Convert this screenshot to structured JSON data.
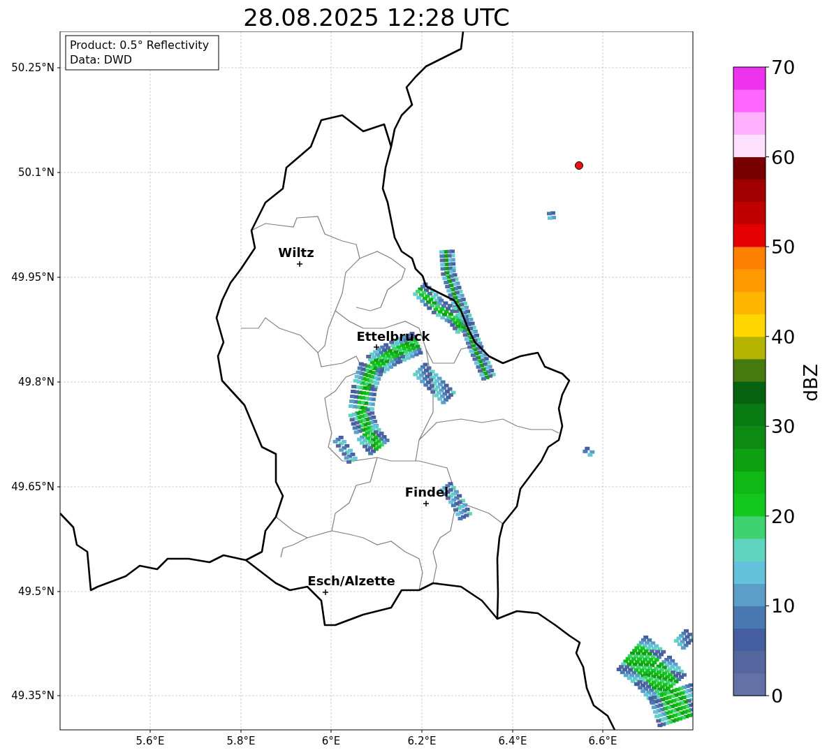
{
  "title": "28.08.2025 12:28 UTC",
  "info_box": [
    "Product: 0.5° Reflectivity",
    "Data: DWD"
  ],
  "map": {
    "lat_ticks": [
      "50.25°N",
      "50.1°N",
      "49.95°N",
      "49.8°N",
      "49.65°N",
      "49.5°N",
      "49.35°N"
    ],
    "lon_ticks": [
      "5.6°E",
      "5.8°E",
      "6°E",
      "6.2°E",
      "6.4°E",
      "6.6°E"
    ],
    "cities": [
      {
        "name": "Wiltz"
      },
      {
        "name": "Ettelbruck"
      },
      {
        "name": "Findel"
      },
      {
        "name": "Esch/Alzette"
      }
    ]
  },
  "colorbar": {
    "label": "dBZ",
    "ticks": [
      "70",
      "60",
      "50",
      "40",
      "30",
      "20",
      "10",
      "0"
    ],
    "segments": [
      {
        "color": "#6471a7"
      },
      {
        "color": "#56679f"
      },
      {
        "color": "#445ea0"
      },
      {
        "color": "#4a78b0"
      },
      {
        "color": "#5b9ec8"
      },
      {
        "color": "#64c2dc"
      },
      {
        "color": "#5fd5c0"
      },
      {
        "color": "#3ed370"
      },
      {
        "color": "#12c81e"
      },
      {
        "color": "#10b816"
      },
      {
        "color": "#0fa012"
      },
      {
        "color": "#0c8a12"
      },
      {
        "color": "#0a7a12"
      },
      {
        "color": "#07620f"
      },
      {
        "color": "#477a0e"
      },
      {
        "color": "#b3b300"
      },
      {
        "color": "#ffd700"
      },
      {
        "color": "#ffb600"
      },
      {
        "color": "#ff9900"
      },
      {
        "color": "#ff7f00"
      },
      {
        "color": "#e50000"
      },
      {
        "color": "#c00000"
      },
      {
        "color": "#a00000"
      },
      {
        "color": "#780000"
      },
      {
        "color": "#ffe0ff"
      },
      {
        "color": "#ffb0ff"
      },
      {
        "color": "#ff66ff"
      },
      {
        "color": "#ee33ee"
      }
    ]
  }
}
